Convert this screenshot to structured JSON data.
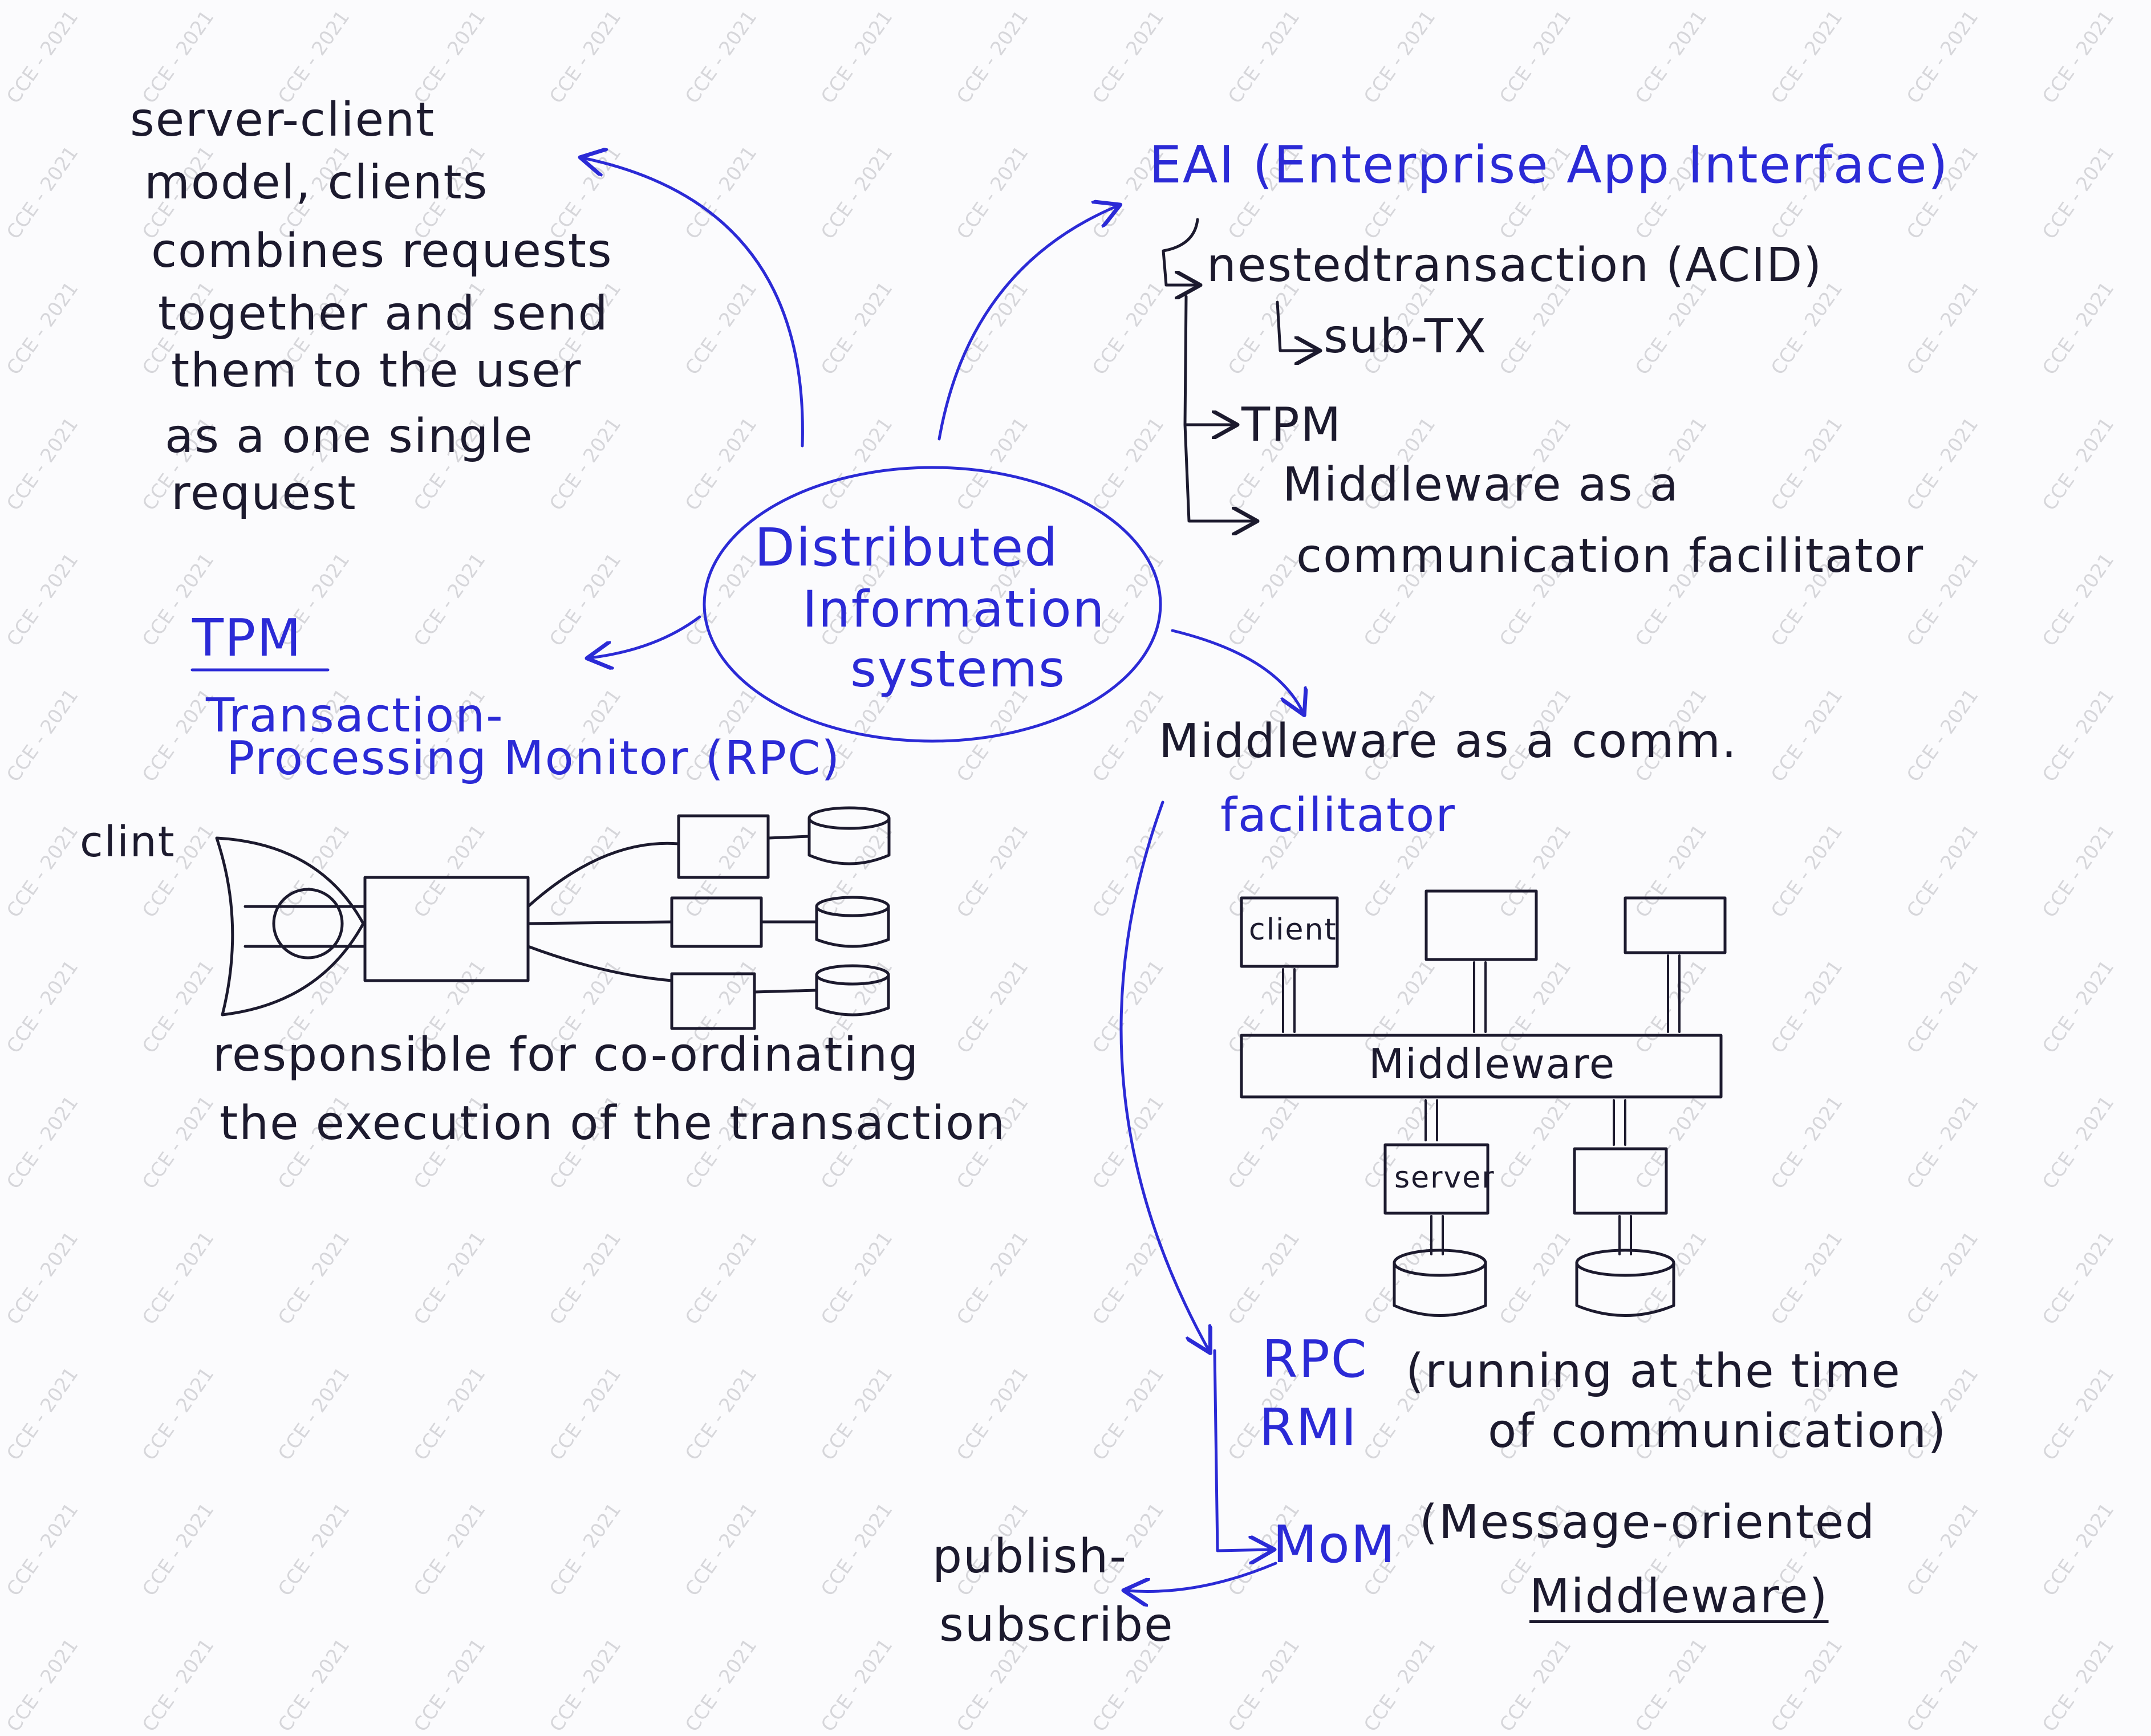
{
  "watermark": "CCE - 2021",
  "colors": {
    "black_ink": "#1c1a2e",
    "blue_ink": "#2b2ad6",
    "paper": "#fbfbfd"
  },
  "center": {
    "lines": [
      "Distributed",
      "Information",
      "systems"
    ]
  },
  "server_client": {
    "lines": [
      "server-client",
      "model, clients",
      "combines requests",
      "together and send",
      "them to the user",
      "as a one single",
      "request"
    ]
  },
  "eai": {
    "title": "EAI (Enterprise App Interface)",
    "items": [
      "nestedtransaction (ACID)",
      "sub-TX",
      "TPM",
      "Middleware as a",
      "communication facilitator"
    ]
  },
  "tpm": {
    "title": "TPM",
    "expansion": [
      "Transaction-",
      "Processing Monitor (RPC)"
    ],
    "client_label": "clint",
    "description": [
      "responsible for co-ordinating",
      "the execution of the transaction"
    ]
  },
  "middleware": {
    "title": "Middleware as a comm.",
    "title2": "facilitator",
    "diagram": {
      "client": "client",
      "bar": "Middleware",
      "server": "server"
    },
    "rpc": "RPC",
    "rmi": "RMI",
    "rpc_note": [
      "(running at the time",
      "of communication)"
    ],
    "mom": "MoM",
    "mom_note": [
      "(Message-oriented",
      "Middleware)"
    ],
    "pubsub": [
      "publish-",
      "subscribe"
    ]
  }
}
